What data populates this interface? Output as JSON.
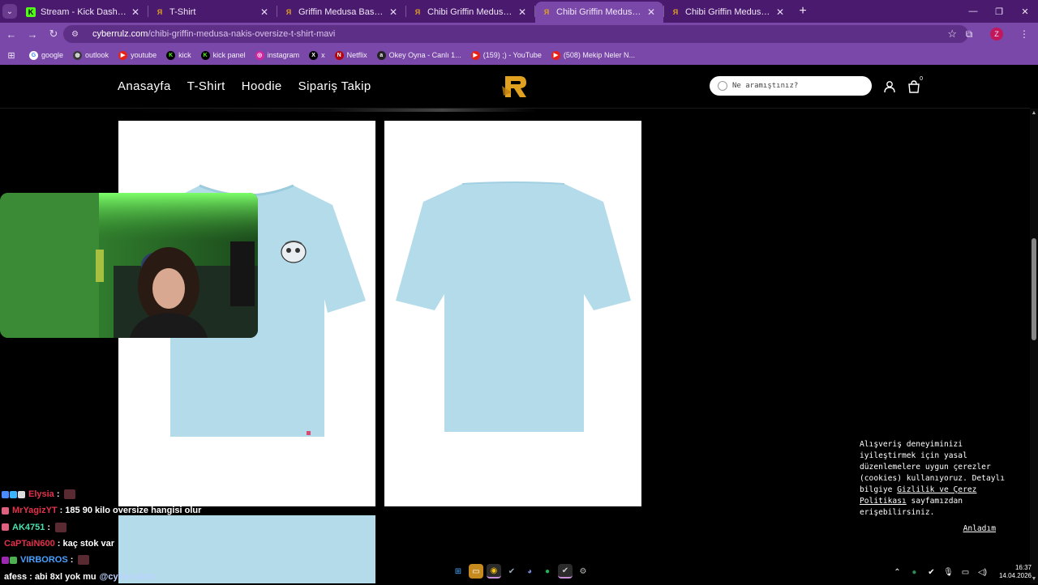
{
  "browser": {
    "tabs": [
      {
        "title": "Stream - Kick Dashboard",
        "favicon": "kick-icon",
        "active": false
      },
      {
        "title": "T-Shirt",
        "favicon": "cyberrulz-icon",
        "active": false
      },
      {
        "title": "Griffin Medusa Baskı T-Shirt - S",
        "favicon": "cyberrulz-icon",
        "active": false
      },
      {
        "title": "Chibi Griffin Medusa Nakış Ove",
        "favicon": "cyberrulz-icon",
        "active": false
      },
      {
        "title": "Chibi Griffin Medusa Nakış Ove",
        "favicon": "cyberrulz-icon",
        "active": true
      },
      {
        "title": "Chibi Griffin Medusa Nakış Ove",
        "favicon": "cyberrulz-icon",
        "active": false
      }
    ],
    "close_glyph": "✕",
    "new_tab_glyph": "+",
    "window_controls": {
      "minimize": "—",
      "restore": "❐",
      "close": "✕"
    },
    "nav": {
      "back": "←",
      "forward": "→",
      "reload": "↻"
    },
    "address": {
      "domain": "cyberrulz.com",
      "path": "/chibi-griffin-medusa-nakis-oversize-t-shirt-mavi"
    },
    "bookmarks": [
      {
        "label": "google",
        "icon": "google-icon",
        "color": "#ffffff",
        "fg": "#4285f4",
        "glyph": "G"
      },
      {
        "label": "outlook",
        "icon": "globe-icon",
        "color": "#3a3a3a",
        "fg": "#ffffff",
        "glyph": "◍"
      },
      {
        "label": "youtube",
        "icon": "youtube-icon",
        "color": "#e62117",
        "fg": "#ffffff",
        "glyph": "▶"
      },
      {
        "label": "kick",
        "icon": "kick-icon",
        "color": "#000000",
        "fg": "#53fc18",
        "glyph": "K"
      },
      {
        "label": "kick panel",
        "icon": "kick-icon",
        "color": "#000000",
        "fg": "#53fc18",
        "glyph": "K"
      },
      {
        "label": "instagram",
        "icon": "instagram-icon",
        "color": "#d6249f",
        "fg": "#ffffff",
        "glyph": "◎"
      },
      {
        "label": "x",
        "icon": "x-icon",
        "color": "#000000",
        "fg": "#ffffff",
        "glyph": "X"
      },
      {
        "label": "Netflix",
        "icon": "netflix-icon",
        "color": "#b20710",
        "fg": "#ffffff",
        "glyph": "N"
      },
      {
        "label": "Okey Oyna - Canlı 1...",
        "icon": "okey-icon",
        "color": "#222222",
        "fg": "#ffffff",
        "glyph": "a"
      },
      {
        "label": "(159) ;) - YouTube",
        "icon": "youtube-icon",
        "color": "#e62117",
        "fg": "#ffffff",
        "glyph": "▶"
      },
      {
        "label": "(508) Mekip Neler N...",
        "icon": "youtube-icon",
        "color": "#e62117",
        "fg": "#ffffff",
        "glyph": "▶"
      }
    ]
  },
  "site": {
    "nav": [
      "Anasayfa",
      "T-Shirt",
      "Hoodie",
      "Sipariş Takip"
    ],
    "search_placeholder": "Ne aramıştınız?",
    "cart_count": "0",
    "cookie": {
      "text_before": "Alışveriş deneyiminizi iyileştirmek için yasal düzenlemelere uygun çerezler (cookies) kullanıyoruz. Detaylı bilgiye ",
      "link": "Gizlilik ve Çerez Politikası",
      "text_after": " sayfamızdan erişebilirsiniz.",
      "accept": "Anladım"
    }
  },
  "colors": {
    "tabbar": "#4a1a6e",
    "toolbar": "#7a48a8",
    "shirt": "#b3dbea",
    "logo": "#e0a020"
  },
  "chat": [
    {
      "user": "Elysia",
      "color": "#e3324b",
      "badges": [
        "#4a8cff",
        "#3ab4ff",
        "#dddddd"
      ],
      "message": "",
      "emote": true
    },
    {
      "user": "MrYagizYT",
      "color": "#e3324b",
      "badges": [
        "#e06080"
      ],
      "message": "185 90 kilo oversize hangisi olur",
      "emote": false
    },
    {
      "user": "AK4751",
      "color": "#4de0b0",
      "badges": [
        "#e06080"
      ],
      "message": "",
      "emote": true
    },
    {
      "user": "CaPTaiN600",
      "color": "#e3324b",
      "badges": [],
      "message": "kaç stok var",
      "emote": false
    },
    {
      "user": "VIRBOROS",
      "color": "#4aa0ff",
      "badges": [
        "#9c27b0",
        "#4caf50"
      ],
      "message": "",
      "emote": true
    },
    {
      "user": "afess",
      "color": "#ffffff",
      "badges": [],
      "message": "abi 8xl yok mu",
      "emote": false,
      "mention": "@cyberrulztv"
    }
  ],
  "taskbar": {
    "time": "16:37",
    "date": "14.04.2026"
  }
}
